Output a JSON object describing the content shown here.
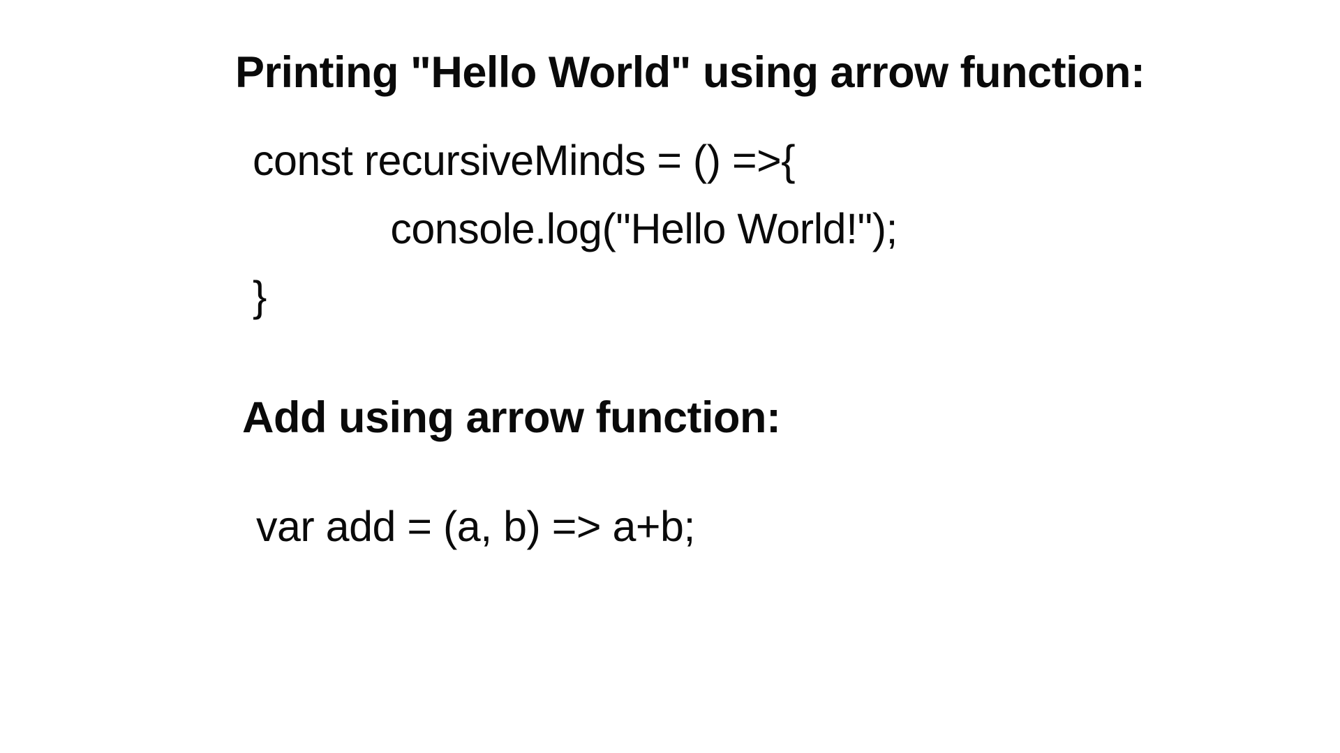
{
  "section1": {
    "heading": "Printing \"Hello World\" using arrow function:",
    "code_line1": "const recursiveMinds = () =>{",
    "code_line2": "            console.log(\"Hello World!\");",
    "code_line3": "}"
  },
  "section2": {
    "heading": "Add using arrow function:",
    "code_line1": "var add = (a, b) => a+b;"
  }
}
